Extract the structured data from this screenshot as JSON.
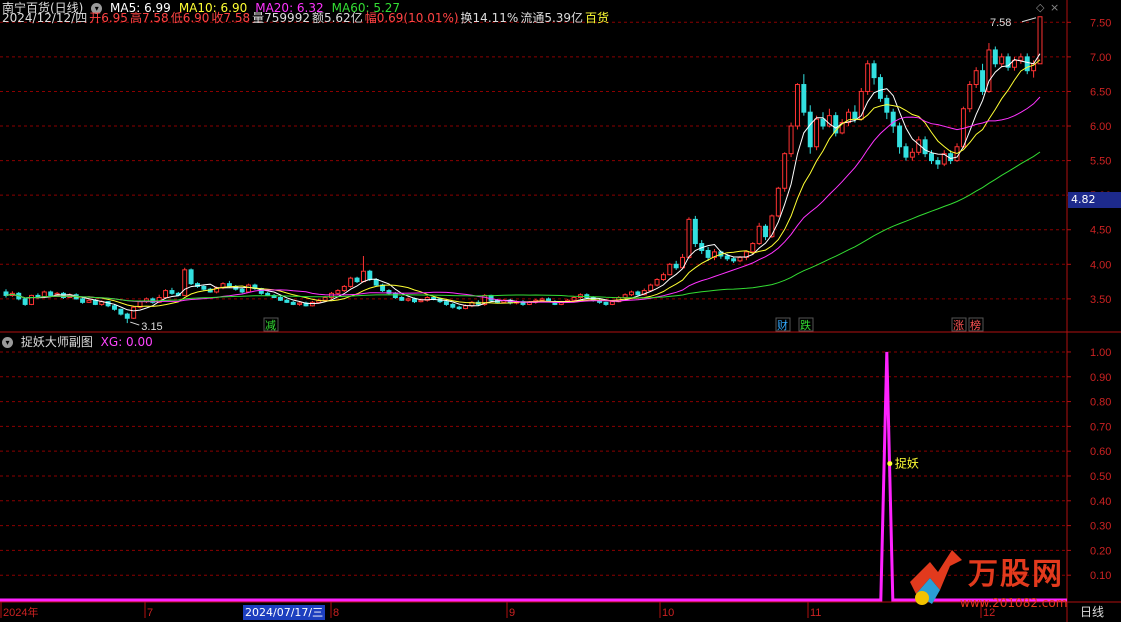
{
  "header": {
    "stock_name": "南宁百货(日线)",
    "ma_labels": [
      {
        "text": "MA5: 6.99",
        "color": "#ffffff"
      },
      {
        "text": "MA10: 6.90",
        "color": "#ffff33"
      },
      {
        "text": "MA20: 6.32",
        "color": "#ff33ff"
      },
      {
        "text": "MA60: 5.27",
        "color": "#33dd33"
      }
    ],
    "quote_fields": [
      {
        "text": "2024/12/12/四",
        "color": "#dddddd"
      },
      {
        "text": "开6.95",
        "color": "#ff4444"
      },
      {
        "text": "高7.58",
        "color": "#ff4444"
      },
      {
        "text": "低6.90",
        "color": "#ff4444"
      },
      {
        "text": "收7.58",
        "color": "#ff4444"
      },
      {
        "text": "量759992",
        "color": "#dddddd"
      },
      {
        "text": "额5.62亿",
        "color": "#dddddd"
      },
      {
        "text": "幅0.69(10.01%)",
        "color": "#ff4444"
      },
      {
        "text": "换14.11%",
        "color": "#dddddd"
      },
      {
        "text": "流通5.39亿",
        "color": "#dddddd"
      },
      {
        "text": "百货",
        "color": "#ffff33"
      }
    ]
  },
  "sub_header": {
    "indicator_name": "捉妖大师副图",
    "xg_label": "XG: 0.00"
  },
  "current_price_tag": "4.82",
  "axis_bottom": {
    "labels": [
      "2024年",
      "7",
      "8",
      "9",
      "10",
      "11",
      "12"
    ],
    "cursor_date": "2024/07/17/三",
    "period": "日线"
  },
  "logo": {
    "text": "万股网",
    "url": "www.201082.com"
  },
  "colors": {
    "up": "#ff3333",
    "down": "#33e0e0",
    "grid": "#8b0000",
    "ma5": "#ffffff",
    "ma10": "#ffff33",
    "ma20": "#ff33ff",
    "ma60": "#33dd33",
    "sub_line": "#ff22ff"
  },
  "chart_data": [
    {
      "type": "candlestick",
      "title": "南宁百货(日线)",
      "yticks": [
        3.5,
        4.0,
        4.5,
        5.0,
        5.5,
        6.0,
        6.5,
        7.0,
        7.5
      ],
      "ylim": [
        3.05,
        7.62
      ],
      "grid": true,
      "max_label": "7.58",
      "min_label": "3.15",
      "markers": [
        {
          "text": "减",
          "color": "#33dd33"
        },
        {
          "text": "财",
          "color": "#33aaff"
        },
        {
          "text": "跌",
          "color": "#33dd33"
        },
        {
          "text": "涨",
          "color": "#ff5555"
        },
        {
          "text": "榜",
          "color": "#ff5555"
        }
      ],
      "candles": [
        [
          3.6,
          3.55,
          3.64,
          3.52
        ],
        [
          3.55,
          3.58,
          3.61,
          3.53
        ],
        [
          3.58,
          3.5,
          3.6,
          3.48
        ],
        [
          3.5,
          3.42,
          3.52,
          3.4
        ],
        [
          3.42,
          3.55,
          3.56,
          3.41
        ],
        [
          3.55,
          3.53,
          3.58,
          3.51
        ],
        [
          3.53,
          3.6,
          3.62,
          3.52
        ],
        [
          3.6,
          3.55,
          3.62,
          3.54
        ],
        [
          3.55,
          3.58,
          3.6,
          3.53
        ],
        [
          3.58,
          3.52,
          3.6,
          3.5
        ],
        [
          3.52,
          3.56,
          3.58,
          3.51
        ],
        [
          3.56,
          3.5,
          3.58,
          3.49
        ],
        [
          3.5,
          3.45,
          3.52,
          3.43
        ],
        [
          3.45,
          3.48,
          3.5,
          3.44
        ],
        [
          3.48,
          3.42,
          3.5,
          3.41
        ],
        [
          3.42,
          3.46,
          3.48,
          3.4
        ],
        [
          3.46,
          3.4,
          3.47,
          3.38
        ],
        [
          3.4,
          3.35,
          3.42,
          3.33
        ],
        [
          3.35,
          3.28,
          3.36,
          3.26
        ],
        [
          3.28,
          3.22,
          3.3,
          3.15
        ],
        [
          3.22,
          3.38,
          3.4,
          3.21
        ],
        [
          3.38,
          3.46,
          3.48,
          3.36
        ],
        [
          3.46,
          3.5,
          3.52,
          3.44
        ],
        [
          3.5,
          3.45,
          3.52,
          3.43
        ],
        [
          3.45,
          3.52,
          3.56,
          3.44
        ],
        [
          3.52,
          3.62,
          3.64,
          3.5
        ],
        [
          3.62,
          3.58,
          3.66,
          3.56
        ],
        [
          3.58,
          3.55,
          3.6,
          3.54
        ],
        [
          3.55,
          3.92,
          3.95,
          3.54
        ],
        [
          3.92,
          3.72,
          3.94,
          3.7
        ],
        [
          3.72,
          3.68,
          3.74,
          3.66
        ],
        [
          3.68,
          3.64,
          3.7,
          3.62
        ],
        [
          3.64,
          3.6,
          3.66,
          3.59
        ],
        [
          3.6,
          3.66,
          3.68,
          3.58
        ],
        [
          3.66,
          3.72,
          3.74,
          3.64
        ],
        [
          3.72,
          3.68,
          3.76,
          3.66
        ],
        [
          3.68,
          3.64,
          3.7,
          3.62
        ],
        [
          3.64,
          3.6,
          3.66,
          3.58
        ],
        [
          3.6,
          3.7,
          3.72,
          3.59
        ],
        [
          3.7,
          3.65,
          3.72,
          3.63
        ],
        [
          3.65,
          3.58,
          3.66,
          3.56
        ],
        [
          3.58,
          3.55,
          3.6,
          3.54
        ],
        [
          3.55,
          3.52,
          3.57,
          3.51
        ],
        [
          3.52,
          3.48,
          3.54,
          3.47
        ],
        [
          3.48,
          3.45,
          3.5,
          3.44
        ],
        [
          3.45,
          3.42,
          3.47,
          3.41
        ],
        [
          3.42,
          3.44,
          3.46,
          3.4
        ],
        [
          3.44,
          3.4,
          3.46,
          3.39
        ],
        [
          3.4,
          3.45,
          3.47,
          3.39
        ],
        [
          3.45,
          3.48,
          3.5,
          3.44
        ],
        [
          3.48,
          3.52,
          3.54,
          3.46
        ],
        [
          3.52,
          3.58,
          3.6,
          3.5
        ],
        [
          3.58,
          3.62,
          3.64,
          3.56
        ],
        [
          3.62,
          3.68,
          3.7,
          3.6
        ],
        [
          3.68,
          3.8,
          3.82,
          3.66
        ],
        [
          3.8,
          3.75,
          3.82,
          3.73
        ],
        [
          3.75,
          3.9,
          4.12,
          3.74
        ],
        [
          3.9,
          3.78,
          3.92,
          3.76
        ],
        [
          3.78,
          3.7,
          3.8,
          3.68
        ],
        [
          3.7,
          3.62,
          3.72,
          3.6
        ],
        [
          3.62,
          3.58,
          3.64,
          3.56
        ],
        [
          3.58,
          3.52,
          3.6,
          3.5
        ],
        [
          3.52,
          3.48,
          3.54,
          3.47
        ],
        [
          3.48,
          3.5,
          3.52,
          3.46
        ],
        [
          3.5,
          3.46,
          3.52,
          3.44
        ],
        [
          3.46,
          3.48,
          3.5,
          3.45
        ],
        [
          3.48,
          3.52,
          3.54,
          3.46
        ],
        [
          3.52,
          3.5,
          3.54,
          3.48
        ],
        [
          3.5,
          3.46,
          3.52,
          3.44
        ],
        [
          3.46,
          3.42,
          3.48,
          3.4
        ],
        [
          3.42,
          3.38,
          3.44,
          3.36
        ],
        [
          3.38,
          3.36,
          3.4,
          3.34
        ],
        [
          3.36,
          3.4,
          3.42,
          3.35
        ],
        [
          3.4,
          3.45,
          3.47,
          3.38
        ],
        [
          3.45,
          3.42,
          3.48,
          3.4
        ],
        [
          3.42,
          3.55,
          3.57,
          3.4
        ],
        [
          3.55,
          3.48,
          3.56,
          3.46
        ],
        [
          3.48,
          3.45,
          3.5,
          3.44
        ],
        [
          3.45,
          3.48,
          3.5,
          3.44
        ],
        [
          3.48,
          3.44,
          3.5,
          3.42
        ],
        [
          3.44,
          3.46,
          3.48,
          3.42
        ],
        [
          3.46,
          3.42,
          3.48,
          3.4
        ],
        [
          3.42,
          3.45,
          3.47,
          3.41
        ],
        [
          3.45,
          3.48,
          3.5,
          3.43
        ],
        [
          3.48,
          3.5,
          3.52,
          3.46
        ],
        [
          3.5,
          3.46,
          3.52,
          3.45
        ],
        [
          3.46,
          3.42,
          3.48,
          3.41
        ],
        [
          3.42,
          3.45,
          3.47,
          3.41
        ],
        [
          3.45,
          3.48,
          3.5,
          3.44
        ],
        [
          3.48,
          3.52,
          3.54,
          3.46
        ],
        [
          3.52,
          3.56,
          3.58,
          3.5
        ],
        [
          3.56,
          3.52,
          3.58,
          3.5
        ],
        [
          3.52,
          3.48,
          3.54,
          3.46
        ],
        [
          3.48,
          3.45,
          3.5,
          3.43
        ],
        [
          3.45,
          3.42,
          3.46,
          3.4
        ],
        [
          3.42,
          3.46,
          3.48,
          3.41
        ],
        [
          3.46,
          3.52,
          3.54,
          3.45
        ],
        [
          3.52,
          3.56,
          3.58,
          3.5
        ],
        [
          3.56,
          3.6,
          3.62,
          3.54
        ],
        [
          3.6,
          3.56,
          3.62,
          3.54
        ],
        [
          3.56,
          3.62,
          3.65,
          3.55
        ],
        [
          3.62,
          3.7,
          3.72,
          3.6
        ],
        [
          3.7,
          3.78,
          3.8,
          3.68
        ],
        [
          3.78,
          3.85,
          3.88,
          3.76
        ],
        [
          3.85,
          4.0,
          4.02,
          3.84
        ],
        [
          4.0,
          3.95,
          4.05,
          3.92
        ],
        [
          3.95,
          4.1,
          4.15,
          3.94
        ],
        [
          4.1,
          4.65,
          4.68,
          4.08
        ],
        [
          4.65,
          4.3,
          4.7,
          4.25
        ],
        [
          4.3,
          4.2,
          4.35,
          4.15
        ],
        [
          4.2,
          4.1,
          4.25,
          4.05
        ],
        [
          4.1,
          4.18,
          4.22,
          4.06
        ],
        [
          4.18,
          4.12,
          4.2,
          4.08
        ],
        [
          4.12,
          4.08,
          4.15,
          4.05
        ],
        [
          4.08,
          4.05,
          4.1,
          4.02
        ],
        [
          4.05,
          4.1,
          4.12,
          4.03
        ],
        [
          4.1,
          4.18,
          4.2,
          4.06
        ],
        [
          4.18,
          4.3,
          4.32,
          4.15
        ],
        [
          4.3,
          4.55,
          4.6,
          4.28
        ],
        [
          4.55,
          4.4,
          4.58,
          4.35
        ],
        [
          4.4,
          4.7,
          4.72,
          4.38
        ],
        [
          4.7,
          5.1,
          5.12,
          4.68
        ],
        [
          5.1,
          5.6,
          5.62,
          5.05
        ],
        [
          5.6,
          6.0,
          6.05,
          5.55
        ],
        [
          6.0,
          6.6,
          6.62,
          5.95
        ],
        [
          6.6,
          6.2,
          6.75,
          6.15
        ],
        [
          6.2,
          5.7,
          6.3,
          5.6
        ],
        [
          5.7,
          6.1,
          6.15,
          5.65
        ],
        [
          6.1,
          6.0,
          6.2,
          5.95
        ],
        [
          6.0,
          6.15,
          6.25,
          5.98
        ],
        [
          6.15,
          5.9,
          6.2,
          5.85
        ],
        [
          5.9,
          6.05,
          6.1,
          5.88
        ],
        [
          6.05,
          6.2,
          6.25,
          6.0
        ],
        [
          6.2,
          6.1,
          6.3,
          6.05
        ],
        [
          6.1,
          6.5,
          6.55,
          6.08
        ],
        [
          6.5,
          6.9,
          6.95,
          6.45
        ],
        [
          6.9,
          6.7,
          6.95,
          6.6
        ],
        [
          6.7,
          6.4,
          6.75,
          6.35
        ],
        [
          6.4,
          6.2,
          6.45,
          6.1
        ],
        [
          6.2,
          6.0,
          6.25,
          5.9
        ],
        [
          6.0,
          5.7,
          6.05,
          5.6
        ],
        [
          5.7,
          5.55,
          5.75,
          5.5
        ],
        [
          5.55,
          5.62,
          5.68,
          5.5
        ],
        [
          5.62,
          5.8,
          5.85,
          5.58
        ],
        [
          5.8,
          5.6,
          5.85,
          5.55
        ],
        [
          5.6,
          5.5,
          5.65,
          5.45
        ],
        [
          5.5,
          5.45,
          5.55,
          5.38
        ],
        [
          5.45,
          5.6,
          5.65,
          5.42
        ],
        [
          5.6,
          5.5,
          5.65,
          5.45
        ],
        [
          5.5,
          5.7,
          5.75,
          5.48
        ],
        [
          5.7,
          6.25,
          6.28,
          5.68
        ],
        [
          6.25,
          6.6,
          6.65,
          6.2
        ],
        [
          6.6,
          6.8,
          6.85,
          6.55
        ],
        [
          6.8,
          6.5,
          6.9,
          6.45
        ],
        [
          6.5,
          7.1,
          7.2,
          6.48
        ],
        [
          7.1,
          6.9,
          7.15,
          6.85
        ],
        [
          6.9,
          7.0,
          7.05,
          6.85
        ],
        [
          7.0,
          6.85,
          7.05,
          6.8
        ],
        [
          6.85,
          6.95,
          7.0,
          6.8
        ],
        [
          6.95,
          7.0,
          7.05,
          6.9
        ],
        [
          7.0,
          6.8,
          7.05,
          6.75
        ],
        [
          6.8,
          6.9,
          6.95,
          6.7
        ],
        [
          6.9,
          7.58,
          7.58,
          6.9
        ]
      ]
    },
    {
      "type": "line",
      "title": "捉妖大师副图",
      "series": [
        {
          "name": "XG",
          "values_note": "spike"
        }
      ],
      "yticks": [
        0.1,
        0.2,
        0.3,
        0.4,
        0.5,
        0.6,
        0.7,
        0.8,
        0.9,
        1.0
      ],
      "ylim": [
        0.0,
        1.02
      ],
      "grid": true,
      "spike_index": 138,
      "annotation": "捉妖"
    }
  ]
}
